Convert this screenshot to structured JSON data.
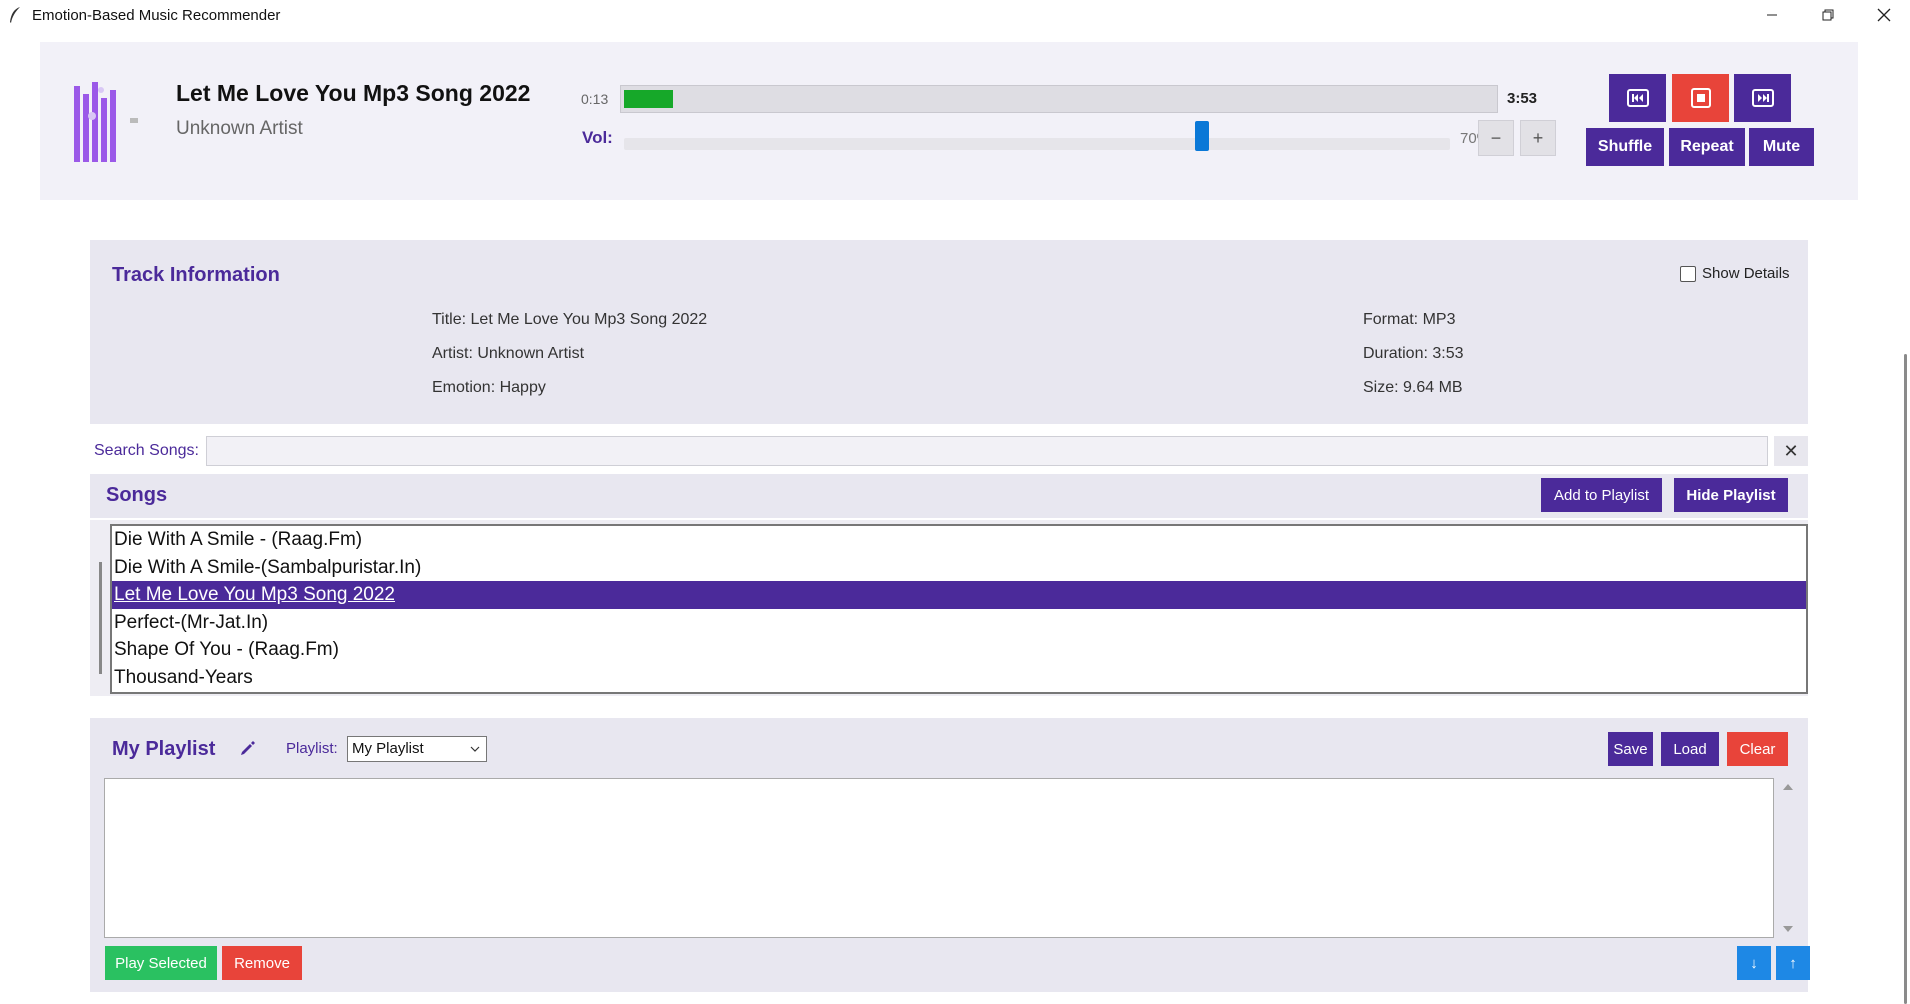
{
  "window": {
    "title": "Emotion-Based Music Recommender",
    "controls": [
      "minimize",
      "restore",
      "close"
    ]
  },
  "player": {
    "track_title": "Let Me Love You Mp3 Song 2022",
    "artist": "Unknown Artist",
    "time_current": "0:13",
    "time_total": "3:53",
    "progress_fraction": 0.056,
    "volume_label": "Vol:",
    "volume_percent": "70%",
    "volume_level": 0.7,
    "vol_down_label": "−",
    "vol_up_label": "+",
    "buttons": {
      "prev_icon": "skip-previous-icon",
      "stop_icon": "stop-icon",
      "next_icon": "skip-next-icon",
      "shuffle": "Shuffle",
      "repeat": "Repeat",
      "mute": "Mute"
    },
    "colors": {
      "accent": "#4b2a9a",
      "stop": "#e8443a",
      "progress": "#16a829",
      "volume_thumb": "#0a78d7"
    }
  },
  "track_info": {
    "heading": "Track Information",
    "show_details_label": "Show Details",
    "show_details_checked": false,
    "left": [
      "Title: Let Me Love You Mp3 Song 2022",
      "Artist: Unknown Artist",
      "Emotion: Happy"
    ],
    "right": [
      "Format: MP3",
      "Duration: 3:53",
      "Size: 9.64 MB"
    ]
  },
  "search": {
    "label": "Search Songs:",
    "value": "",
    "clear_label": "✕"
  },
  "songs": {
    "heading": "Songs",
    "add_to_playlist": "Add to Playlist",
    "hide_playlist": "Hide Playlist",
    "items": [
      "Die With A Smile - (Raag.Fm)",
      "Die With A Smile-(Sambalpuristar.In)",
      "Let Me Love You Mp3 Song 2022",
      "Perfect-(Mr-Jat.In)",
      "Shape Of You - (Raag.Fm)",
      "Thousand-Years"
    ],
    "selected_index": 2
  },
  "playlist": {
    "heading": "My Playlist",
    "selector_label": "Playlist:",
    "selected": "My Playlist",
    "save": "Save",
    "load": "Load",
    "clear": "Clear",
    "play_selected": "Play Selected",
    "remove": "Remove",
    "move_down": "↓",
    "move_up": "↑",
    "items": []
  }
}
